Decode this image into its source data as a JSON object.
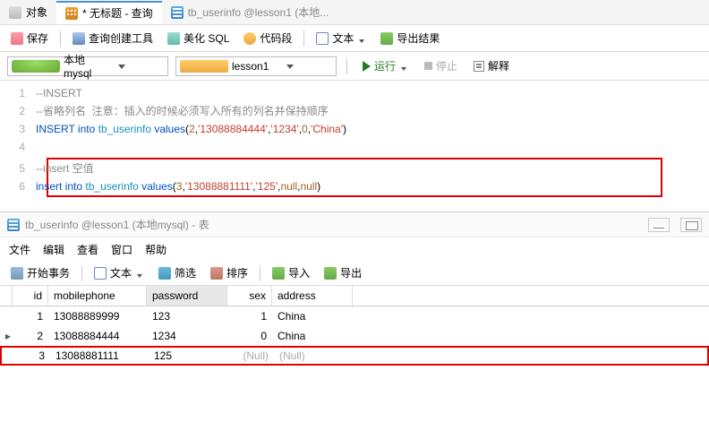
{
  "tabs": {
    "obj": "对象",
    "query": "* 无标题 - 查询",
    "userinfo": "tb_userinfo @lesson1 (本地..."
  },
  "toolbar": {
    "save": "保存",
    "querybuilder": "查询创建工具",
    "beautify": "美化 SQL",
    "codesnip": "代码段",
    "text": "文本",
    "export": "导出结果"
  },
  "combos": {
    "conn": "本地mysql",
    "db": "lesson1"
  },
  "actions": {
    "run": "运行",
    "stop": "停止",
    "explain": "解释"
  },
  "code": {
    "l1": "--INSERT",
    "l2a": "--省略列名",
    "l2b": "注意：插入的时候必须写入所有的列名并保持顺序",
    "l3": {
      "kw1": "INSERT",
      "kw2": "into",
      "id": "tb_userinfo",
      "fn": "values",
      "args": [
        "2",
        "'13088884444'",
        "'1234'",
        "0",
        "'China'"
      ]
    },
    "l5": "--insert 空值",
    "l6": {
      "kw1": "insert",
      "kw2": "into",
      "id": "tb_userinfo",
      "fn": "values",
      "args": [
        "3",
        "'13088881111'",
        "'125'",
        "null",
        "null"
      ]
    }
  },
  "sub": {
    "title": "tb_userinfo @lesson1 (本地mysql) - 表",
    "menu": [
      "文件",
      "编辑",
      "查看",
      "窗口",
      "帮助"
    ],
    "tb": {
      "begin": "开始事务",
      "text": "文本",
      "filter": "筛选",
      "sort": "排序",
      "import": "导入",
      "export": "导出"
    },
    "cols": [
      "id",
      "mobilephone",
      "password",
      "sex",
      "address"
    ],
    "rows": [
      {
        "mark": "",
        "id": "1",
        "mobile": "13088889999",
        "pw": "123",
        "sex": "1",
        "addr": "China"
      },
      {
        "mark": "▸",
        "id": "2",
        "mobile": "13088884444",
        "pw": "1234",
        "sex": "0",
        "addr": "China"
      },
      {
        "mark": "",
        "id": "3",
        "mobile": "13088881111",
        "pw": "125",
        "sex": "(Null)",
        "addr": "(Null)"
      }
    ]
  }
}
